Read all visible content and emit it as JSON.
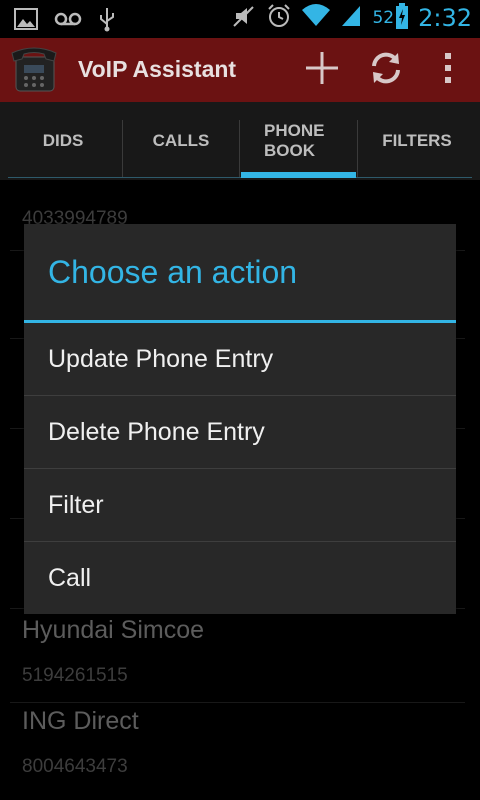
{
  "status_bar": {
    "battery_percent": "52",
    "time": "2:32",
    "icons": [
      "gallery-icon",
      "voicemail-icon",
      "usb-icon",
      "mute-icon",
      "alarm-icon",
      "wifi-icon",
      "signal-icon",
      "battery-icon"
    ]
  },
  "action_bar": {
    "title": "VoIP Assistant",
    "background": "#6b1212",
    "actions": [
      "add-icon",
      "refresh-icon",
      "overflow-menu-icon"
    ]
  },
  "tabs": [
    {
      "label": "DIDS"
    },
    {
      "label": "CALLS"
    },
    {
      "label": "PHONE BOOK",
      "line1": "PHONE",
      "line2": "BOOK",
      "active": true
    },
    {
      "label": "FILTERS"
    }
  ],
  "accent_color": "#33b5e5",
  "phone_book": [
    {
      "name": "",
      "number": "4033994789"
    },
    {
      "name": "Hyundai Simcoe",
      "number": "5194261515"
    },
    {
      "name": "ING Direct",
      "number": "8004643473"
    }
  ],
  "dialog": {
    "title": "Choose an action",
    "items": [
      "Update Phone Entry",
      "Delete Phone Entry",
      "Filter",
      "Call"
    ]
  }
}
